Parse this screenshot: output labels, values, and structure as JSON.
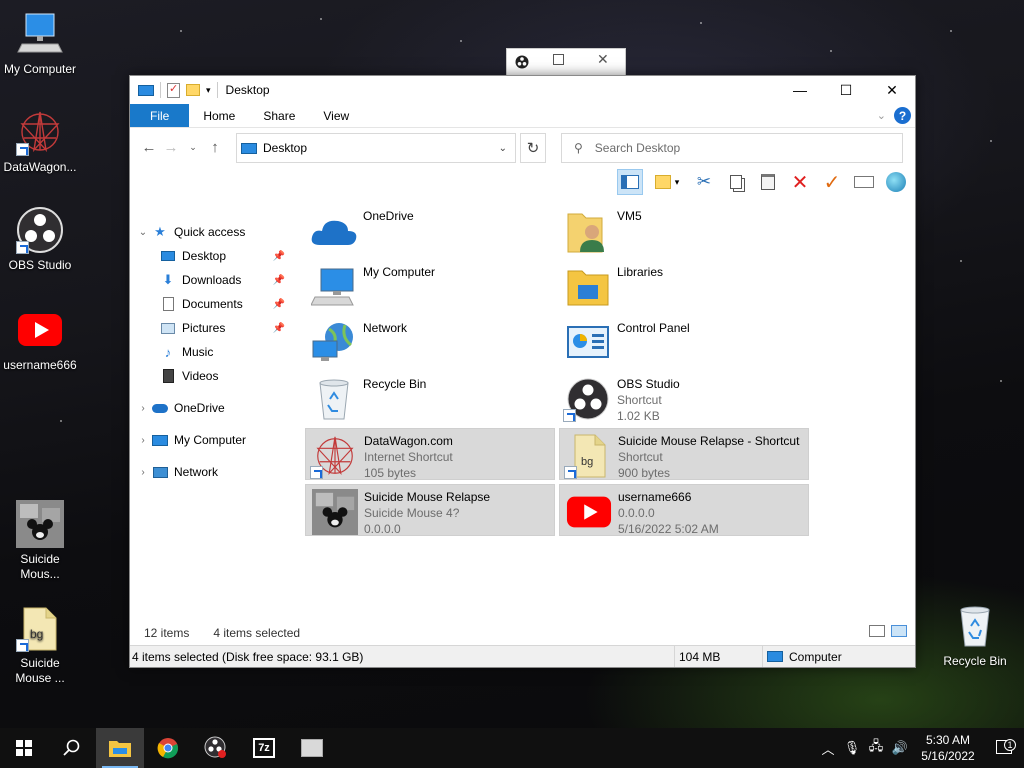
{
  "desktop": {
    "icons": [
      {
        "label": "My Computer",
        "icon": "my-computer-icon"
      },
      {
        "label": "DataWagon...",
        "icon": "datawagon-icon"
      },
      {
        "label": "OBS Studio",
        "icon": "obs-icon"
      },
      {
        "label": "username666",
        "icon": "youtube-icon"
      },
      {
        "label": "Suicide Mous...",
        "icon": "mickey-icon"
      },
      {
        "label": "Suicide Mouse ...",
        "icon": "bg-file-icon"
      },
      {
        "label": "Recycle Bin",
        "icon": "recycle-bin-icon"
      }
    ]
  },
  "explorer": {
    "title": "Desktop",
    "controls": {
      "minimize": "—",
      "maximize": "☐",
      "close": "✕"
    },
    "ribbon_tabs": [
      "File",
      "Home",
      "Share",
      "View"
    ],
    "address": "Desktop",
    "search_placeholder": "Search Desktop",
    "nav": {
      "quick_access": "Quick access",
      "quick_items": [
        {
          "label": "Desktop",
          "pinned": true
        },
        {
          "label": "Downloads",
          "pinned": true
        },
        {
          "label": "Documents",
          "pinned": true
        },
        {
          "label": "Pictures",
          "pinned": true
        },
        {
          "label": "Music",
          "pinned": false
        },
        {
          "label": "Videos",
          "pinned": false
        }
      ],
      "onedrive": "OneDrive",
      "my_computer": "My Computer",
      "network": "Network"
    },
    "items": [
      {
        "name": "OneDrive",
        "sub1": "",
        "sub2": "",
        "selected": false,
        "icon": "onedrive-cloud-icon"
      },
      {
        "name": "VM5",
        "sub1": "",
        "sub2": "",
        "selected": false,
        "icon": "user-folder-icon"
      },
      {
        "name": "My Computer",
        "sub1": "",
        "sub2": "",
        "selected": false,
        "icon": "computer-icon"
      },
      {
        "name": "Libraries",
        "sub1": "",
        "sub2": "",
        "selected": false,
        "icon": "libraries-icon"
      },
      {
        "name": "Network",
        "sub1": "",
        "sub2": "",
        "selected": false,
        "icon": "network-icon"
      },
      {
        "name": "Control Panel",
        "sub1": "",
        "sub2": "",
        "selected": false,
        "icon": "control-panel-icon"
      },
      {
        "name": "Recycle Bin",
        "sub1": "",
        "sub2": "",
        "selected": false,
        "icon": "recycle-bin-icon"
      },
      {
        "name": "OBS Studio",
        "sub1": "Shortcut",
        "sub2": "1.02 KB",
        "selected": false,
        "icon": "obs-icon"
      },
      {
        "name": "DataWagon.com",
        "sub1": "Internet Shortcut",
        "sub2": "105 bytes",
        "selected": true,
        "icon": "datawagon-icon"
      },
      {
        "name": "Suicide Mouse Relapse - Shortcut",
        "sub1": "Shortcut",
        "sub2": "900 bytes",
        "selected": true,
        "icon": "bg-file-icon"
      },
      {
        "name": "Suicide Mouse Relapse",
        "sub1": "Suicide Mouse 4?",
        "sub2": "0.0.0.0",
        "selected": true,
        "icon": "mickey-icon"
      },
      {
        "name": "username666",
        "sub1": "0.0.0.0",
        "sub2": "5/16/2022 5:02 AM",
        "selected": true,
        "icon": "youtube-icon"
      }
    ],
    "status": {
      "count": "12 items",
      "selected": "4 items selected"
    },
    "infobar": {
      "details": "4 items selected (Disk free space: 93.1 GB)",
      "size": "104 MB",
      "location": "Computer"
    }
  },
  "taskbar": {
    "apps": [
      "start-icon",
      "search-icon",
      "file-explorer-icon",
      "chrome-icon",
      "obs-icon",
      "7zip-icon",
      "vm-icon"
    ],
    "time": "5:30 AM",
    "date": "5/16/2022",
    "notifications": "1"
  },
  "colors": {
    "accent": "#1979ca",
    "selection": "#d9d9d9",
    "taskbar": "#101010"
  }
}
